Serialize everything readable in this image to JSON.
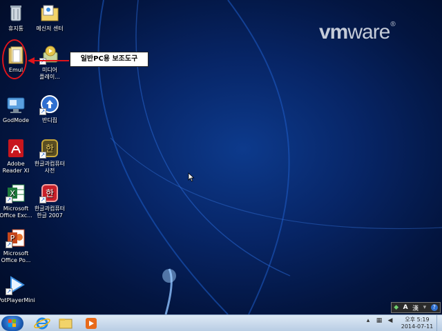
{
  "desktop": {
    "brand": {
      "logo_text": "vmware",
      "logo_bold": "vm",
      "logo_rest": "ware",
      "logo_reg": "®"
    },
    "icons": [
      {
        "label": "휴지통",
        "icon": "recycle-bin-icon"
      },
      {
        "label": "메신저 센터",
        "icon": "messenger-center-icon"
      },
      {
        "label": "Emul",
        "icon": "folder-icon"
      },
      {
        "label_line1": "미디어",
        "label_line2": "플레이...",
        "icon": "media-player-icon"
      },
      {
        "label": "GodMode",
        "icon": "godmode-icon"
      },
      {
        "label": "반디집",
        "icon": "bandizip-icon"
      },
      {
        "label_line1": "Adobe",
        "label_line2": "Reader XI",
        "icon": "adobe-reader-icon"
      },
      {
        "label_line1": "한글과컴퓨터",
        "label_line2": "사전",
        "icon": "hancom-dictionary-icon"
      },
      {
        "label_line1": "Microsoft",
        "label_line2": "Office Exc...",
        "icon": "excel-icon"
      },
      {
        "label_line1": "한글과컴퓨터",
        "label_line2": "한글 2007",
        "icon": "hwp-icon"
      },
      {
        "label_line1": "Microsoft",
        "label_line2": "Office Po...",
        "icon": "powerpoint-icon"
      },
      {
        "label": "PotPlayerMini",
        "icon": "potplayer-icon"
      }
    ],
    "annotation": {
      "callout_text": "일반PC용 보조도구",
      "color": "#e0141b"
    }
  },
  "langbar": {
    "mode": "A",
    "hanja": "漢"
  },
  "taskbar": {
    "pinned": [
      "internet-explorer-icon",
      "explorer-folder-icon",
      "media-player-icon"
    ],
    "clock": {
      "time": "오후 5:19",
      "date": "2014-07-11"
    }
  },
  "colors": {
    "desktop_blue": "#072566",
    "callout_border": "#222222",
    "taskbar": "#c9dbee"
  }
}
